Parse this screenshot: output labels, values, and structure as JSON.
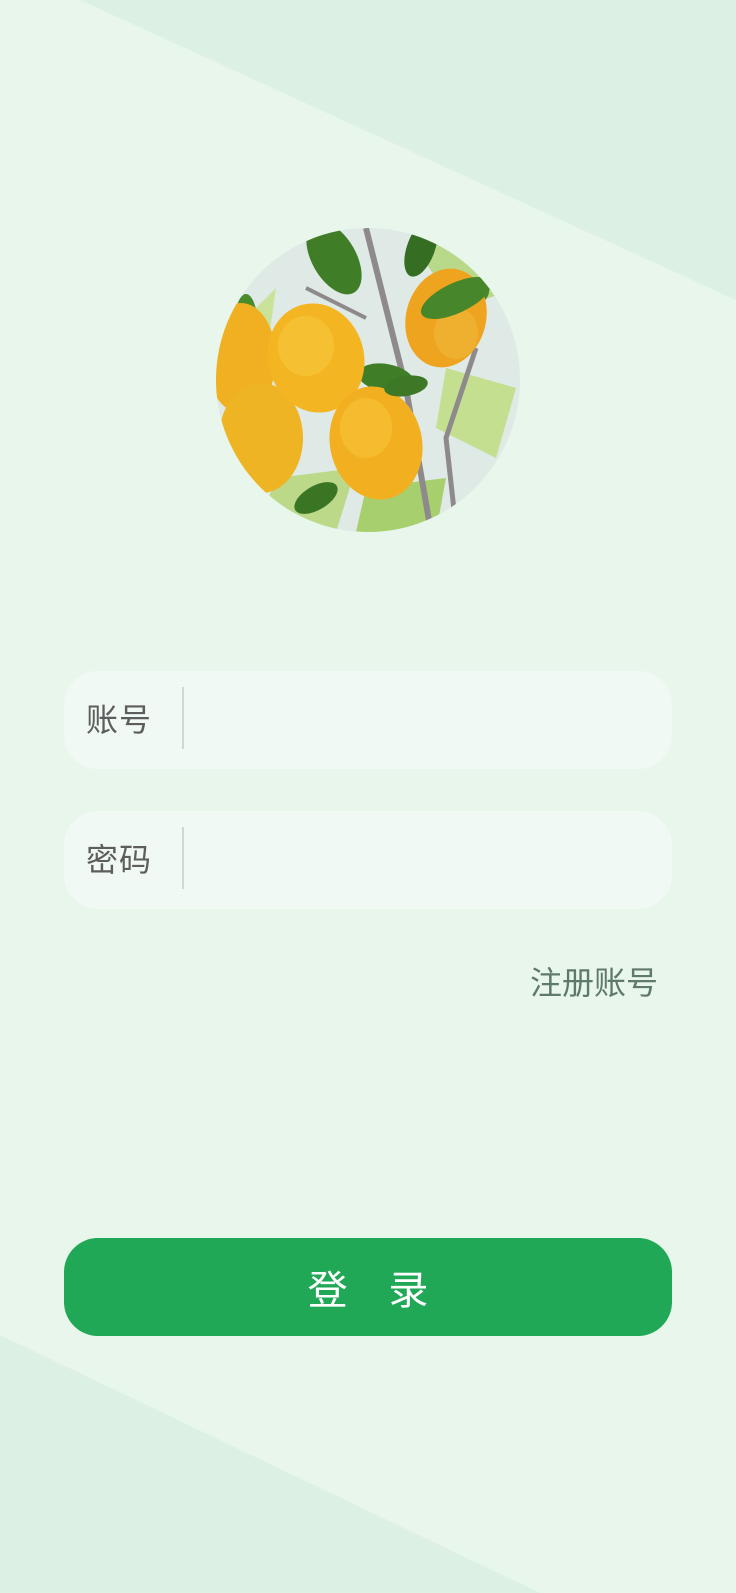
{
  "avatar": {
    "icon": "lemon-painting-avatar"
  },
  "form": {
    "account_label": "账号",
    "account_value": "",
    "password_label": "密码",
    "password_value": ""
  },
  "register_link": "注册账号",
  "login_button": "登 录",
  "colors": {
    "background": "#e8f6ec",
    "primary": "#20a857",
    "field_bg": "#f1f9f4"
  }
}
